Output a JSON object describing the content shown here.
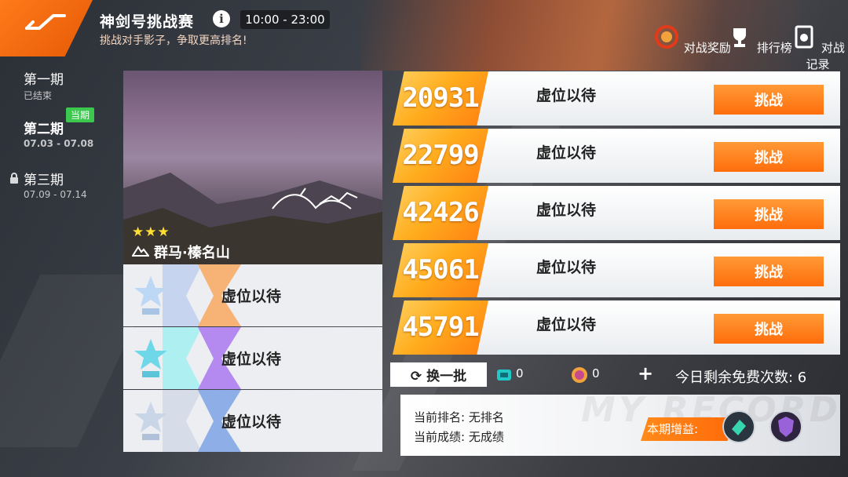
{
  "header": {
    "title": "神剑号挑战赛",
    "time": "10:00 - 23:00",
    "subtitle": "挑战对手影子，争取更高排名!"
  },
  "top_actions": [
    {
      "label": "对战奖励",
      "icon": "reward-icon"
    },
    {
      "label": "排行榜",
      "icon": "trophy-icon"
    },
    {
      "label": "对战记录",
      "icon": "record-icon"
    }
  ],
  "seasons": [
    {
      "name": "第一期",
      "sub": "已结束",
      "state": "ended"
    },
    {
      "name": "第二期",
      "sub": "07.03 - 07.08",
      "state": "current",
      "badge": "当期"
    },
    {
      "name": "第三期",
      "sub": "07.09 - 07.14",
      "state": "locked"
    }
  ],
  "track": {
    "stars": "★★★",
    "name": "群马·榛名山"
  },
  "ranking_cards": [
    {
      "name": "虚位以待",
      "tier": "1"
    },
    {
      "name": "虚位以待",
      "tier": "2"
    },
    {
      "name": "虚位以待",
      "tier": "3"
    }
  ],
  "opponents": [
    {
      "score": "20931",
      "name": "虚位以待",
      "button": "挑战"
    },
    {
      "score": "22799",
      "name": "虚位以待",
      "button": "挑战"
    },
    {
      "score": "42426",
      "name": "虚位以待",
      "button": "挑战"
    },
    {
      "score": "45061",
      "name": "虚位以待",
      "button": "挑战"
    },
    {
      "score": "45791",
      "name": "虚位以待",
      "button": "挑战"
    }
  ],
  "bottom": {
    "refresh_label": "换一批",
    "ticket_count": "0",
    "coin_count": "0",
    "plus": "+",
    "free_attempts": "今日剩余免费次数: 6"
  },
  "records": {
    "rank_line": "当前排名: 无排名",
    "score_line": "当前成绩: 无成绩",
    "buff_label": "本期增益:",
    "watermark": "MY RECORDS"
  },
  "colors": {
    "accent": "#ff7a1a",
    "star": "#ffe032",
    "current_badge": "#3cc84e"
  }
}
